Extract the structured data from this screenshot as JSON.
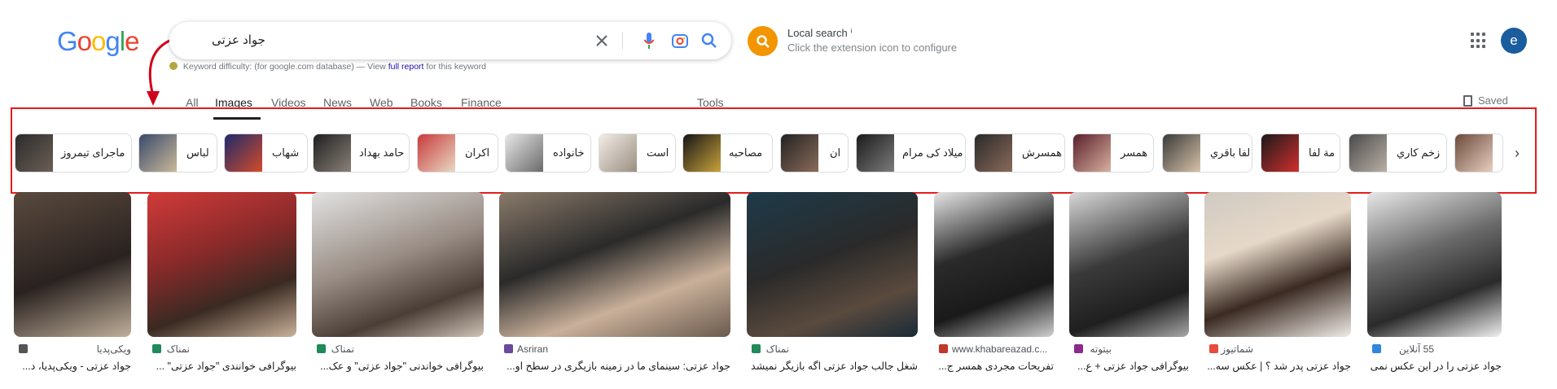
{
  "logo": {
    "g1": "G",
    "o1": "o",
    "o2": "o",
    "g2": "g",
    "l": "l",
    "e": "e"
  },
  "search": {
    "query": "جواد عزتی"
  },
  "extension": {
    "title": "Local search ⁱ",
    "subtitle": "Click the extension icon to configure"
  },
  "avatar": {
    "letter": "e"
  },
  "keyword_bar": {
    "prefix": "Keyword difficulty:",
    "mid": "(for google.com database) — View",
    "link": "full report",
    "suffix": "for this keyword"
  },
  "tabs": [
    {
      "label": "All"
    },
    {
      "label": "Images"
    },
    {
      "label": "Videos"
    },
    {
      "label": "News"
    },
    {
      "label": "Web"
    },
    {
      "label": "Books"
    },
    {
      "label": "Finance"
    },
    {
      "label": "Tools"
    }
  ],
  "saved_label": "Saved",
  "chips": [
    {
      "label": "ماجرای تیمروز"
    },
    {
      "label": "لباس"
    },
    {
      "label": "شهاب"
    },
    {
      "label": "حامد بهداد"
    },
    {
      "label": "اکران"
    },
    {
      "label": "خانواده"
    },
    {
      "label": "است"
    },
    {
      "label": "مصاحبه"
    },
    {
      "label": "ان"
    },
    {
      "label": "میلاد کی مرام"
    },
    {
      "label": "همسرش"
    },
    {
      "label": "همسر"
    },
    {
      "label": "لفا باقري"
    },
    {
      "label": "مة لفا"
    },
    {
      "label": "زخم كاري"
    },
    {
      "label": ""
    }
  ],
  "results": [
    {
      "source": "ویکی‌پدیا",
      "title": "جواد عزتی - ویکی‌پدیا، د..."
    },
    {
      "source": "نمناک",
      "title": "بیوگرافی خوانندی \"جواد عزتی\" ..."
    },
    {
      "source": "نمناک",
      "title": "بیوگرافی خواندنی \"جواد عزتی\" و عک..."
    },
    {
      "source": "Asriran",
      "title": "جواد عزتی: سینمای ما در زمینه بازیگری در سطح او..."
    },
    {
      "source": "نمناک",
      "title": "شغل جالب جواد عزتی اگه بازیگر نمیشد"
    },
    {
      "source": "www.khabareazad.c...",
      "title": "تفریحات مجردی همسر ج..."
    },
    {
      "source": "بیتوته",
      "title": "بیوگرافی جواد عزتی + ع..."
    },
    {
      "source": "شماتیوز",
      "title": "جواد عزتی پدر شد ؟ | عکس سه..."
    },
    {
      "source": "55 آنلاین",
      "title": "جواد عزتی را در این عکس نمی شنا..."
    }
  ],
  "colors": {
    "accent_red": "#e21c1c",
    "google_blue": "#4285f4",
    "extension_orange": "#f29500"
  }
}
